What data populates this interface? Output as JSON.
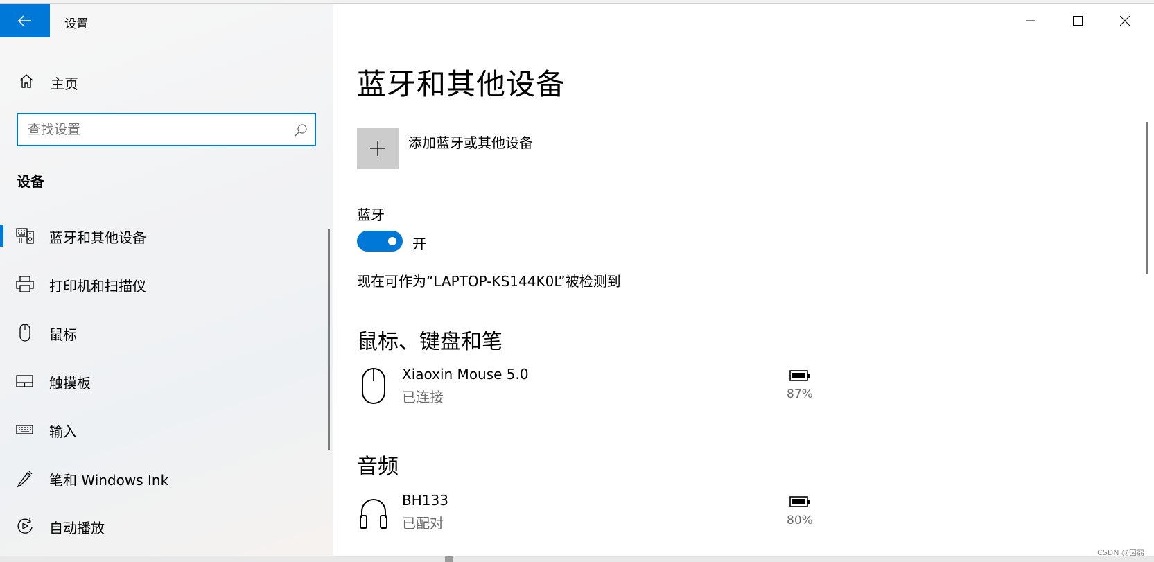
{
  "app": {
    "title": "设置"
  },
  "sidebar": {
    "home_label": "主页",
    "search_placeholder": "查找设置",
    "section_label": "设备",
    "items": [
      {
        "label": "蓝牙和其他设备",
        "icon": "bluetooth-devices-icon",
        "selected": true
      },
      {
        "label": "打印机和扫描仪",
        "icon": "printer-icon",
        "selected": false
      },
      {
        "label": "鼠标",
        "icon": "mouse-icon",
        "selected": false
      },
      {
        "label": "触摸板",
        "icon": "touchpad-icon",
        "selected": false
      },
      {
        "label": "输入",
        "icon": "keyboard-icon",
        "selected": false
      },
      {
        "label": "笔和 Windows Ink",
        "icon": "pen-icon",
        "selected": false
      },
      {
        "label": "自动播放",
        "icon": "autoplay-icon",
        "selected": false
      }
    ]
  },
  "main": {
    "page_title": "蓝牙和其他设备",
    "add_device_label": "添加蓝牙或其他设备",
    "bluetooth_label": "蓝牙",
    "bluetooth_state": "开",
    "bluetooth_on": true,
    "discoverable_text": "现在可作为“LAPTOP-KS144K0L”被检测到",
    "groups": [
      {
        "title": "鼠标、键盘和笔",
        "devices": [
          {
            "name": "Xiaoxin Mouse 5.0",
            "status": "已连接",
            "battery": "87%",
            "icon": "mouse-icon"
          }
        ]
      },
      {
        "title": "音频",
        "devices": [
          {
            "name": "BH133",
            "status": "已配对",
            "battery": "80%",
            "icon": "headphones-icon"
          }
        ]
      }
    ]
  },
  "colors": {
    "accent": "#0078d7",
    "tile": "#cccccc",
    "secondary_text": "#6b6b6b"
  },
  "watermark": "CSDN @囚蒻"
}
